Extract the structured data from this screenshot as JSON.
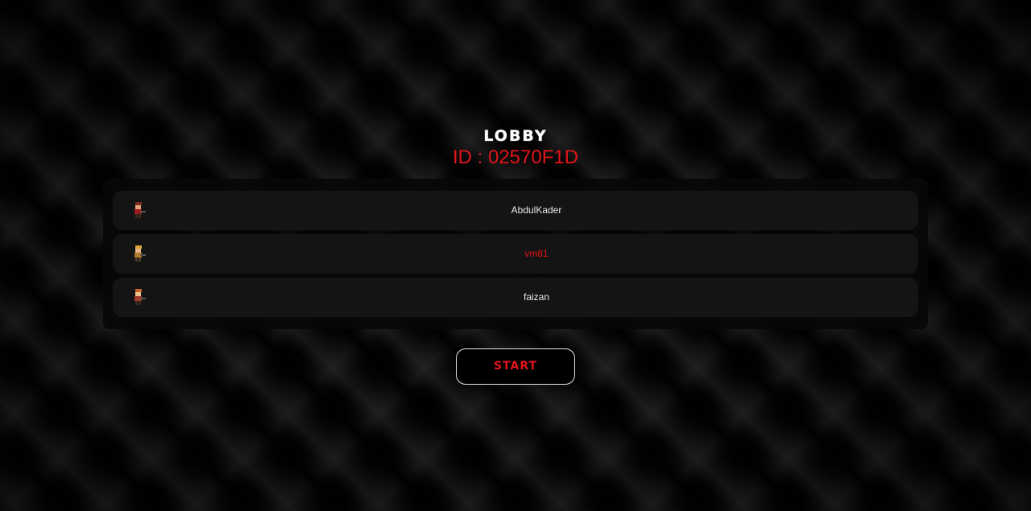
{
  "lobby": {
    "title": "LOBBY",
    "id_text": "ID : 02570F1D"
  },
  "players": [
    {
      "name": "AbdulKader",
      "avatar": "soldier-red-icon",
      "highlighted": false
    },
    {
      "name": "vm81",
      "avatar": "soldier-blonde-icon",
      "highlighted": true
    },
    {
      "name": "faizan",
      "avatar": "soldier-orange-icon",
      "highlighted": false
    }
  ],
  "start_button": {
    "label": "START"
  },
  "colors": {
    "accent": "#e0151b",
    "text": "#e8e8e8",
    "row_background": "#141414",
    "panel_background": "#080808"
  }
}
